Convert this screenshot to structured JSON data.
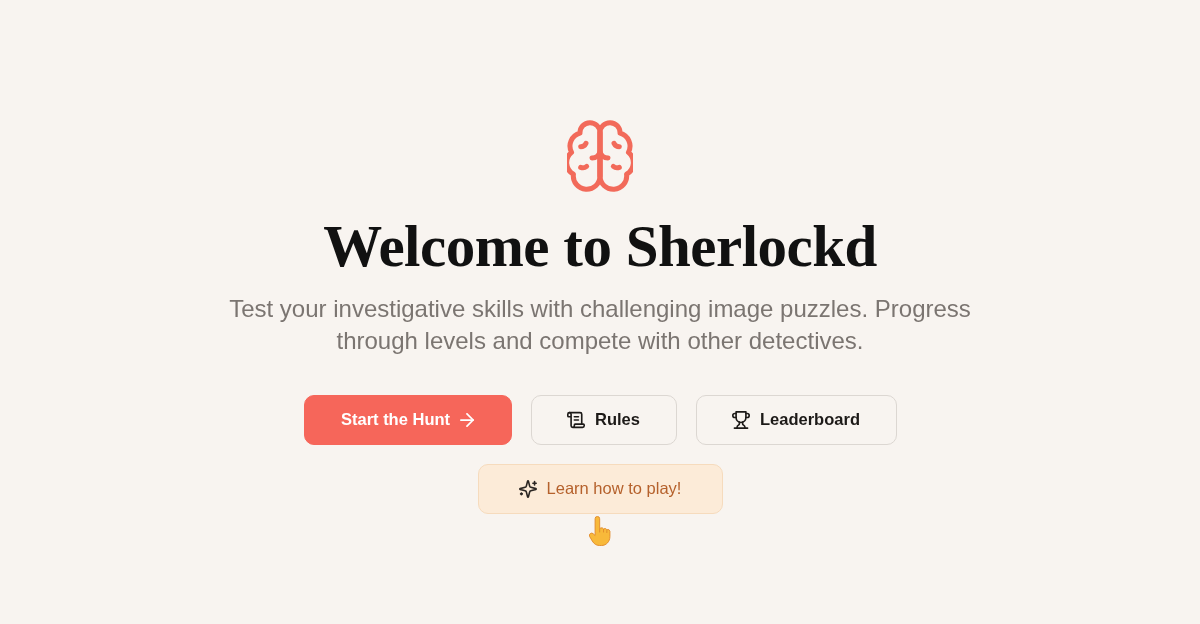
{
  "hero": {
    "title": "Welcome to Sherlockd",
    "subtitle": "Test your investigative skills with challenging image puzzles. Progress through levels and compete with other detectives."
  },
  "actions": [
    {
      "label": "Start the Hunt",
      "kind": "primary"
    },
    {
      "label": "Rules",
      "kind": "outline"
    },
    {
      "label": "Leaderboard",
      "kind": "outline"
    }
  ],
  "tutorial": {
    "label": "Learn how to play!"
  }
}
